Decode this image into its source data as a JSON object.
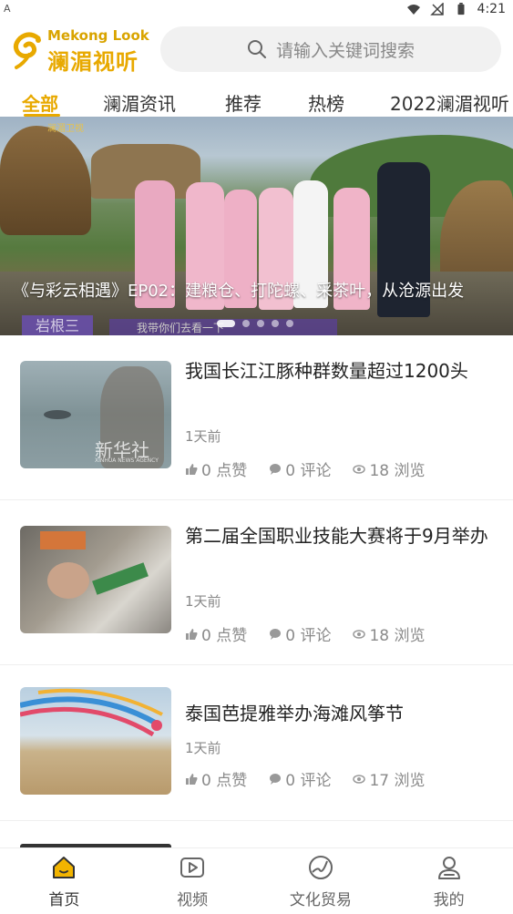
{
  "status_bar": {
    "left_label": "A",
    "time": "4:21"
  },
  "header": {
    "logo_en": "Mekong Look",
    "logo_cn": "澜湄视听",
    "search_placeholder": "请输入关键词搜索"
  },
  "tabs": [
    {
      "label": "全部",
      "active": true
    },
    {
      "label": "澜湄资讯",
      "active": false
    },
    {
      "label": "推荐",
      "active": false
    },
    {
      "label": "热榜",
      "active": false
    },
    {
      "label": "2022澜湄视听",
      "active": false
    }
  ],
  "banner": {
    "caption": "《与彩云相遇》EP02：建粮仓、打陀螺、采茶叶，从沧源出发",
    "corner_tag": "岩根三",
    "sub_tag": "我带你们去看一下",
    "channel": "澜湄卫视",
    "dots_total": 5,
    "dots_active_index": 0
  },
  "news": [
    {
      "title": "我国长江江豚种群数量超过1200头",
      "time": "1天前",
      "likes": "0 点赞",
      "comments": "0 评论",
      "views": "18 浏览",
      "watermark": "新华社",
      "watermark_en": "XINHUA NEWS AGENCY"
    },
    {
      "title": "第二届全国职业技能大赛将于9月举办",
      "time": "1天前",
      "likes": "0 点赞",
      "comments": "0 评论",
      "views": "18 浏览"
    },
    {
      "title": "泰国芭提雅举办海滩风筝节",
      "time": "1天前",
      "likes": "0 点赞",
      "comments": "0 评论",
      "views": "17 浏览"
    }
  ],
  "bottom_nav": [
    {
      "label": "首页",
      "icon": "home-icon",
      "active": true
    },
    {
      "label": "视频",
      "icon": "video-icon",
      "active": false
    },
    {
      "label": "文化贸易",
      "icon": "globe-icon",
      "active": false
    },
    {
      "label": "我的",
      "icon": "user-icon",
      "active": false
    }
  ],
  "colors": {
    "accent": "#e8a900",
    "text": "#222222",
    "muted": "#888888"
  }
}
